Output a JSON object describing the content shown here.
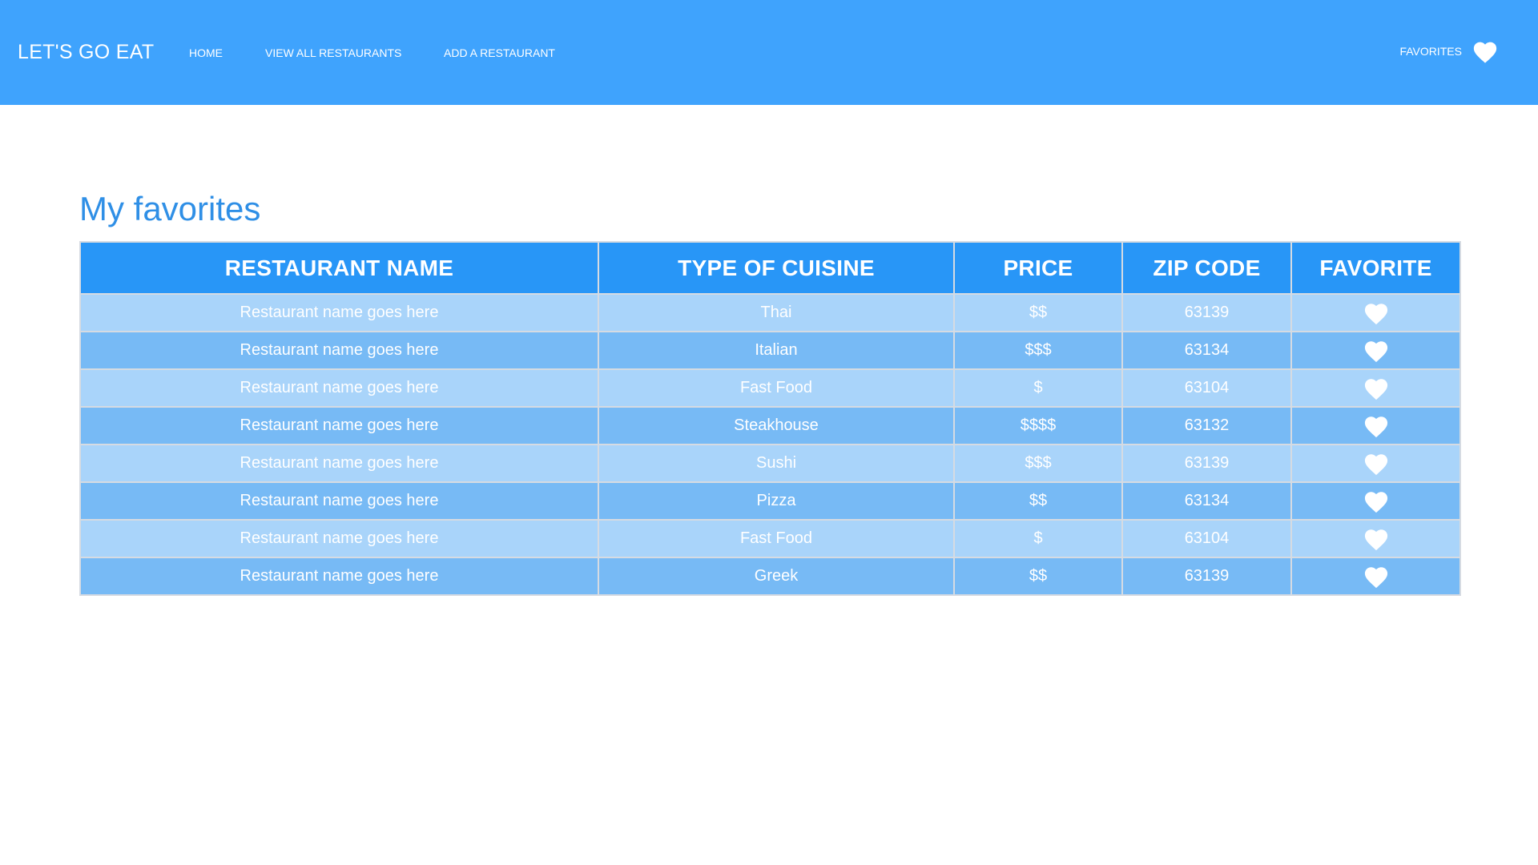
{
  "nav": {
    "brand": "LET'S GO EAT",
    "links": [
      "HOME",
      "VIEW ALL RESTAURANTS",
      "ADD A RESTAURANT"
    ],
    "favorites_label": "FAVORITES",
    "favorites_icon": "heart-icon"
  },
  "main": {
    "title": "My favorites",
    "table": {
      "headers": [
        "RESTAURANT NAME",
        "TYPE OF CUISINE",
        "PRICE",
        "ZIP CODE",
        "FAVORITE"
      ],
      "rows": [
        [
          "Restaurant name goes here",
          "Thai",
          "$$",
          "63139"
        ],
        [
          "Restaurant name goes here",
          "Italian",
          "$$$",
          "63134"
        ],
        [
          "Restaurant name goes here",
          "Fast Food",
          "$",
          "63104"
        ],
        [
          "Restaurant name goes here",
          "Steakhouse",
          "$$$$",
          "63132"
        ],
        [
          "Restaurant name goes here",
          "Sushi",
          "$$$",
          "63139"
        ],
        [
          "Restaurant name goes here",
          "Pizza",
          "$$",
          "63134"
        ],
        [
          "Restaurant name goes here",
          "Fast Food",
          "$",
          "63104"
        ],
        [
          "Restaurant name goes here",
          "Greek",
          "$$",
          "63139"
        ]
      ],
      "favorite_icon": "heart-icon"
    }
  },
  "colors": {
    "navbar": "#3fa3fd",
    "title": "#2f8fe6",
    "table_header": "#2896f7",
    "row_light": "#a9d4fa",
    "row_dark": "#77baf5",
    "border": "#d6dbe2"
  }
}
